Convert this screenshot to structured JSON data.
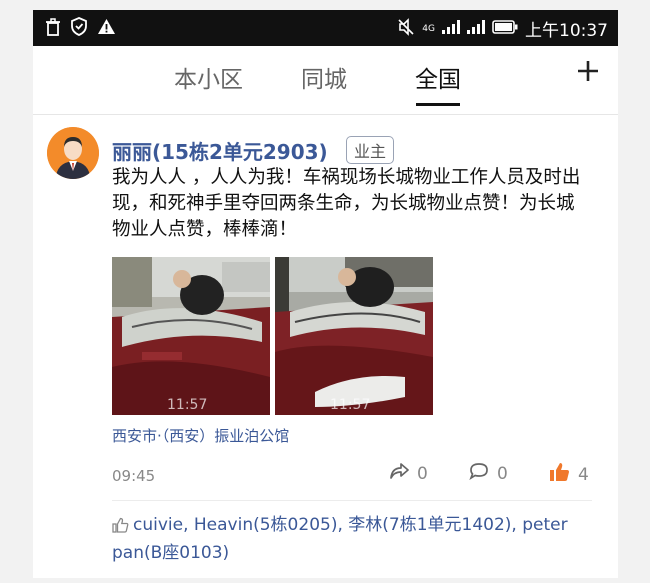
{
  "status_bar": {
    "network": "4G",
    "time": "上午10:37"
  },
  "tabs": [
    {
      "label": "本小区",
      "active": false
    },
    {
      "label": "同城",
      "active": false
    },
    {
      "label": "全国",
      "active": true
    }
  ],
  "add_icon": "plus-icon",
  "post": {
    "username": "丽丽(15栋2单元2903)",
    "badge": "业主",
    "content": "我为人人 ，人人为我！车祸现场长城物业工作人员及时出现，和死神手里夺回两条生命，为长城物业点赞！为长城物业人点赞，棒棒滴！",
    "photos": [
      {
        "timestamp_overlay": "11:57"
      },
      {
        "timestamp_overlay": "11:57"
      }
    ],
    "location": "西安市·（西安）振业泊公馆",
    "time": "09:45",
    "share_count": "0",
    "comment_count": "0",
    "like_count": "4",
    "liked_by": "cuivie, Heavin(5栋0205), 李林(7栋1单元1402), peter pan(B座0103)"
  },
  "colors": {
    "link_blue": "#3b5897",
    "like_orange": "#f0782b",
    "avatar_orange": "#f38b2a",
    "car_red": "#7a1f22"
  }
}
